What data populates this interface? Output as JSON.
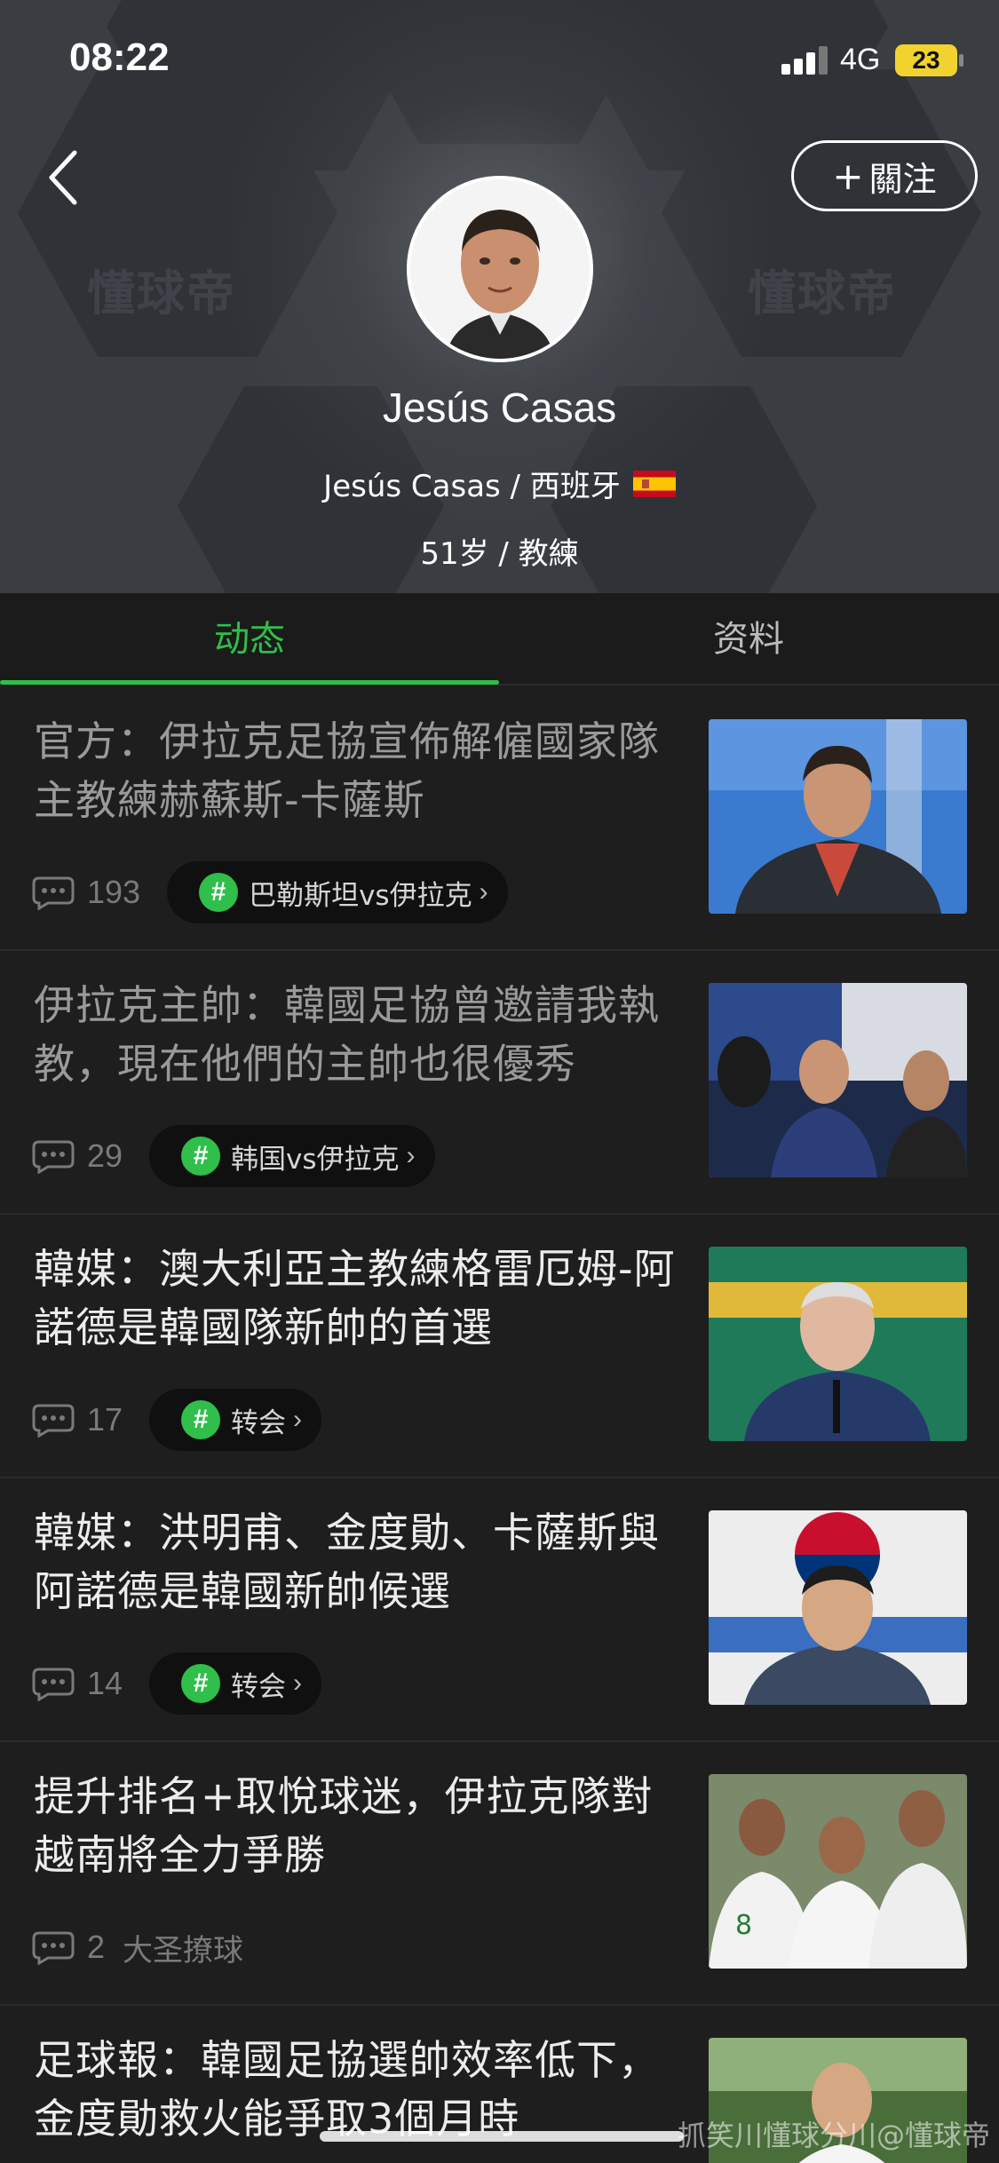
{
  "status_bar": {
    "time": "08:22",
    "network": "4G",
    "battery": "23"
  },
  "header": {
    "follow_label": "關注",
    "name": "Jesús Casas",
    "sub_name": "Jesús Casas / 西班牙",
    "meta": "51岁 / 教練",
    "watermark_logo": "懂球帝"
  },
  "tabs": [
    {
      "label": "动态",
      "active": true
    },
    {
      "label": "资料",
      "active": false
    }
  ],
  "news": [
    {
      "title": "官方：伊拉克足協宣佈解僱國家隊主教練赫蘇斯-卡薩斯",
      "comments": "193",
      "tag": "巴勒斯坦vs伊拉克",
      "read": true
    },
    {
      "title": "伊拉克主帥：韓國足協曾邀請我執教，現在他們的主帥也很優秀",
      "comments": "29",
      "tag": "韩国vs伊拉克",
      "read": true
    },
    {
      "title": "韓媒：澳大利亞主教練格雷厄姆-阿諾德是韓國隊新帥的首選",
      "comments": "17",
      "tag": "转会",
      "read": false
    },
    {
      "title": "韓媒：洪明甫、金度勛、卡薩斯與阿諾德是韓國新帥候選",
      "comments": "14",
      "tag": "转会",
      "read": false
    },
    {
      "title": "提升排名+取悅球迷，伊拉克隊對越南將全力爭勝",
      "comments": "2",
      "source": "大圣撩球",
      "read": false
    },
    {
      "title": "足球報：韓國足協選帥效率低下，金度勛救火能爭取3個月時",
      "comments": "",
      "read": false
    }
  ],
  "overlay_watermark": "抓笑川懂球分川@懂球帝",
  "colors": {
    "accent": "#2fbf4a",
    "background": "#1e1e1e",
    "header": "#3a3d42"
  }
}
